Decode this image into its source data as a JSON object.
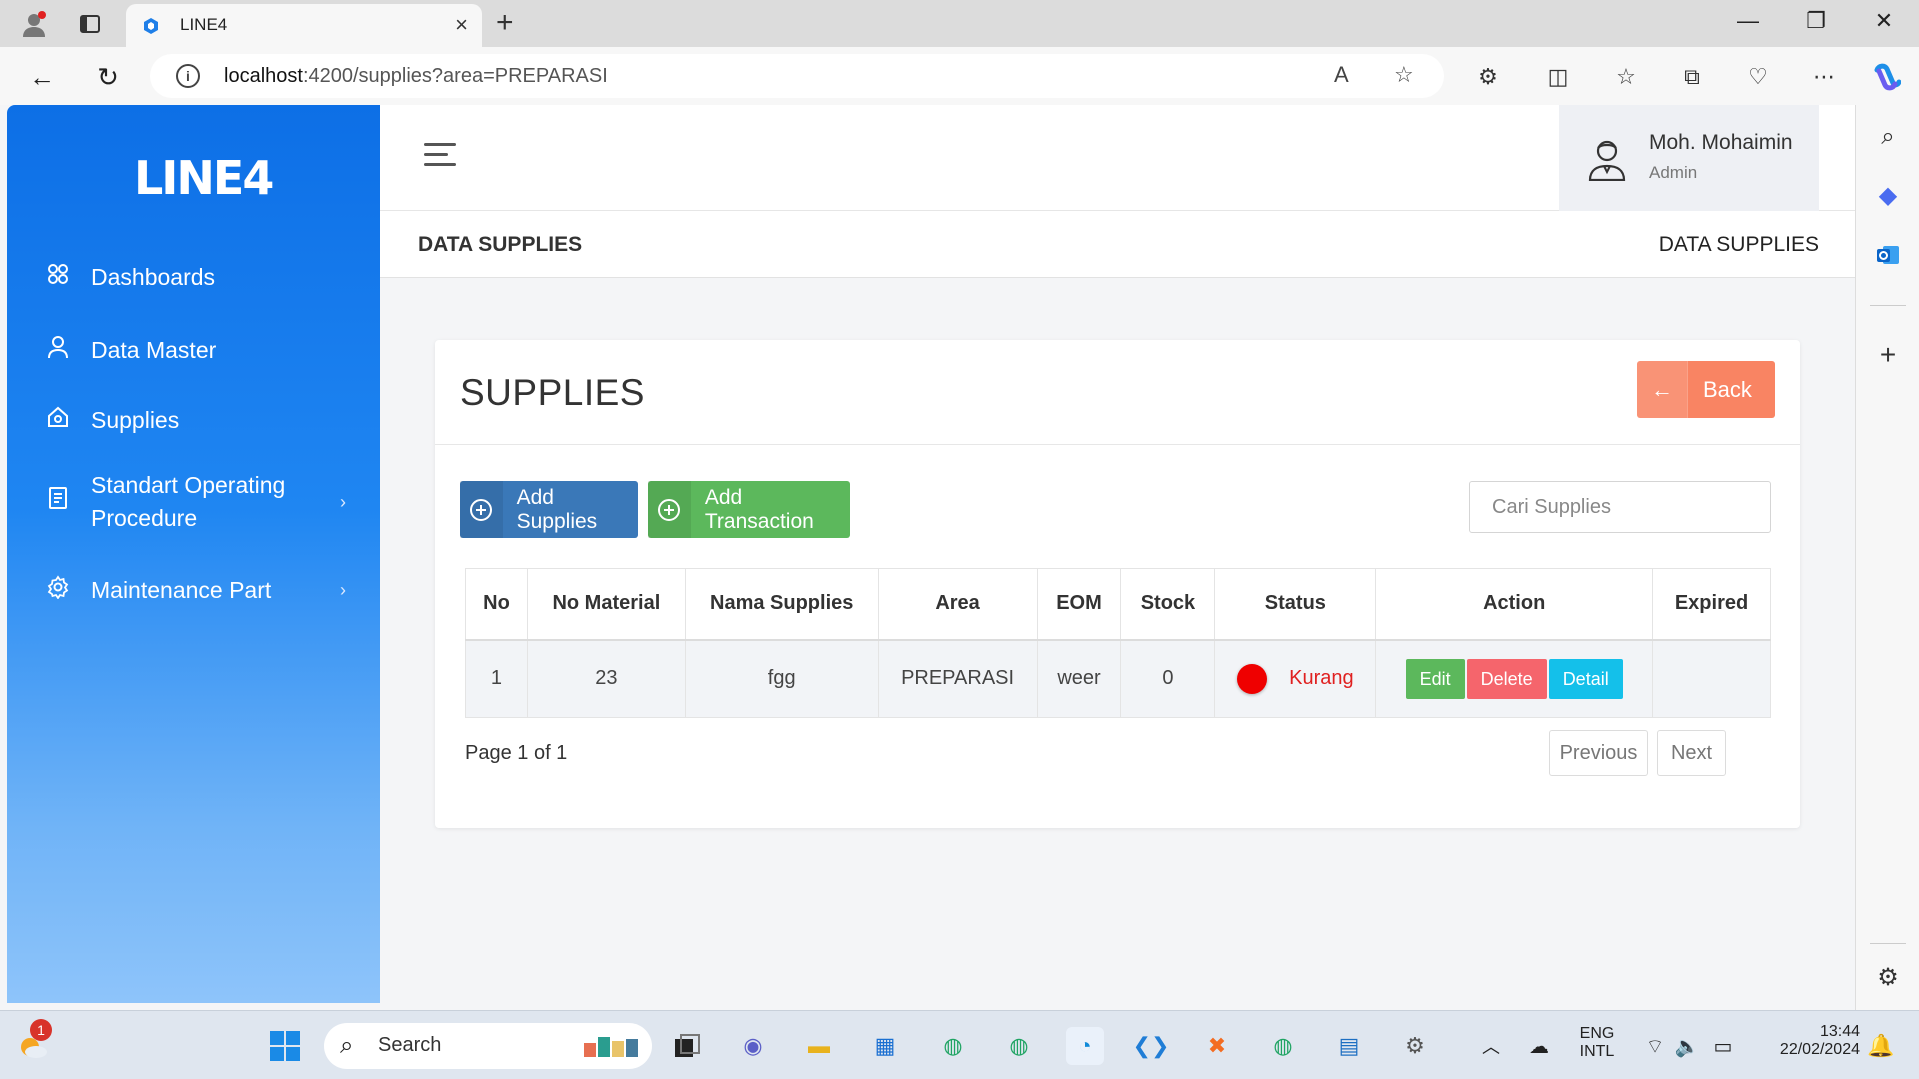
{
  "browser": {
    "tab_title": "LINE4",
    "url_host": "localhost",
    "url_rest": ":4200/supplies?area=PREPARASI"
  },
  "app": {
    "brand": "LINE4",
    "sidebar": {
      "items": [
        {
          "label": "Dashboards",
          "icon": "grid-icon"
        },
        {
          "label": "Data Master",
          "icon": "user-icon"
        },
        {
          "label": "Supplies",
          "icon": "home-icon"
        },
        {
          "label": "Standart Operating",
          "label2": "Procedure",
          "icon": "document-icon",
          "expandable": true
        },
        {
          "label": "Maintenance Part",
          "icon": "gear-icon",
          "expandable": true
        }
      ]
    },
    "user": {
      "name": "Moh. Mohaimin",
      "role": "Admin"
    },
    "breadcrumb": {
      "left": "DATA SUPPLIES",
      "right": "DATA SUPPLIES"
    }
  },
  "page": {
    "title": "SUPPLIES",
    "back_label": "Back",
    "add_supplies_label": "Add Supplies",
    "add_transaction_label": "Add Transaction",
    "search_placeholder": "Cari Supplies",
    "table": {
      "columns": [
        "No",
        "No Material",
        "Nama Supplies",
        "Area",
        "EOM",
        "Stock",
        "Status",
        "Action",
        "Expired"
      ],
      "rows": [
        {
          "no": "1",
          "no_material": "23",
          "nama": "fgg",
          "area": "PREPARASI",
          "eom": "weer",
          "stock": "0",
          "status": "Kurang",
          "expired": ""
        }
      ],
      "actions": {
        "edit": "Edit",
        "delete": "Delete",
        "detail": "Detail"
      }
    },
    "pagination": {
      "info": "Page 1 of 1",
      "previous": "Previous",
      "next": "Next"
    }
  },
  "colors": {
    "sidebar_top": "#0d6fe6",
    "back_button": "#f98463",
    "add_supplies_button": "#3a78b8",
    "add_transaction_button": "#5cb85c",
    "status_red": "#ef0000"
  },
  "taskbar": {
    "search_label": "Search",
    "notification_count": "1",
    "language_top": "ENG",
    "language_bottom": "INTL",
    "time": "13:44",
    "date": "22/02/2024"
  }
}
